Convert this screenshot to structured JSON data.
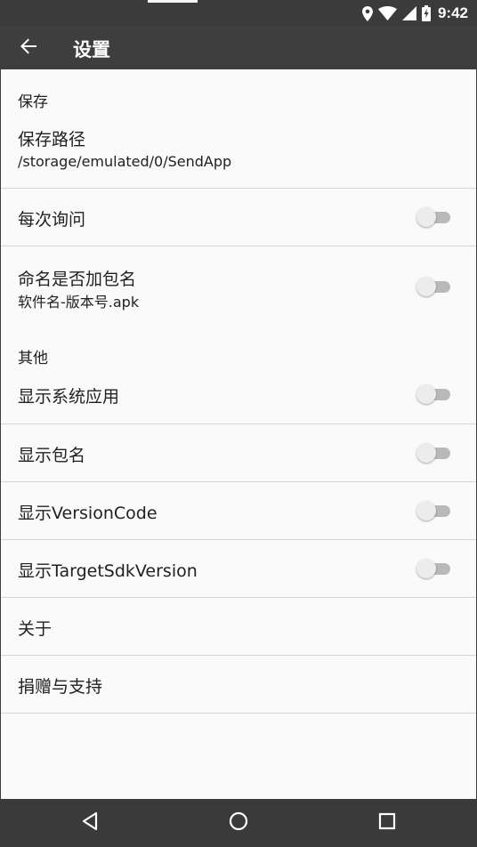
{
  "status_bar": {
    "time": "9:42",
    "icons": [
      "location-icon",
      "wifi-icon",
      "signal-icon",
      "battery-charging-icon"
    ]
  },
  "toolbar": {
    "title": "设置",
    "back_icon": "arrow-back-icon"
  },
  "sections": {
    "save": {
      "header": "保存",
      "save_path_title": "保存路径",
      "save_path_value": "/storage/emulated/0/SendApp",
      "ask_every_time": "每次询问",
      "ask_every_time_on": false,
      "name_with_package_title": "命名是否加包名",
      "name_with_package_summary": "软件名-版本号.apk",
      "name_with_package_on": false
    },
    "other": {
      "header": "其他",
      "show_system_apps": "显示系统应用",
      "show_system_apps_on": false,
      "show_package_name": "显示包名",
      "show_package_name_on": false,
      "show_version_code": "显示VersionCode",
      "show_version_code_on": false,
      "show_target_sdk": "显示TargetSdkVersion",
      "show_target_sdk_on": false,
      "about": "关于",
      "donate": "捐赠与支持"
    }
  },
  "nav_bar": {
    "buttons": [
      "back-triangle-icon",
      "home-circle-icon",
      "recents-square-icon"
    ]
  },
  "colors": {
    "toolbar": "#3e3e3e",
    "status_bar": "#3b3b3b",
    "background": "#fafafa",
    "divider": "#d6d6d6",
    "switch_off_track": "#b9b9b9",
    "switch_off_thumb": "#ececec"
  }
}
